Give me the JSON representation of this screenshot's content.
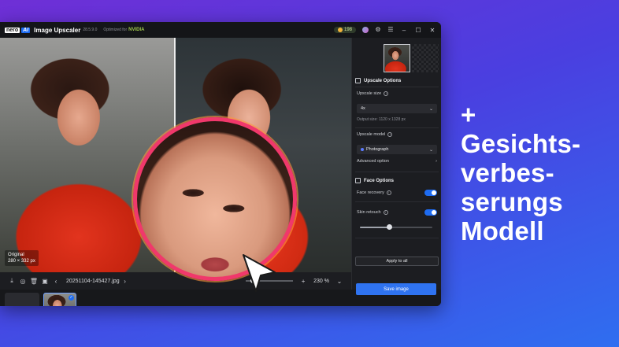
{
  "titlebar": {
    "logo_text": "nero",
    "ai_badge": "AI",
    "app_title": "Image Upscaler",
    "version": "28.5.9.0",
    "optimized_label": "Optimized for",
    "nvidia_label": "NVIDIA",
    "credits": "198"
  },
  "canvas": {
    "original_label": "Original",
    "original_size": "280 × 332 px"
  },
  "zoombar": {
    "filename": "20251104-145427.jpg",
    "zoom_value": "230 %",
    "zoom_level": 0.15
  },
  "filmstrip": {
    "add_symbol": "+",
    "thumb_badge": "x4"
  },
  "panel": {
    "upscale_options_title": "Upscale Options",
    "upscale_size_label": "Upscale size",
    "upscale_size_value": "4x",
    "output_size": "Output size: 1120 x 1328 px",
    "upscale_model_label": "Upscale model",
    "upscale_model_value": "Photograph",
    "advanced_option": "Advanced option",
    "face_options_title": "Face Options",
    "face_recovery_label": "Face recovery",
    "skin_retouch_label": "Skin retouch",
    "skin_retouch_level": 0.4,
    "apply_to_all": "Apply to all",
    "save_image": "Save image"
  },
  "promo": {
    "line1": "+",
    "line2": "Gesichts-",
    "line3": "verbes-",
    "line4": "serungs",
    "line5": "Modell"
  },
  "colors": {
    "accent": "#2f73f0",
    "magnifier_ring": "#f0386b"
  }
}
